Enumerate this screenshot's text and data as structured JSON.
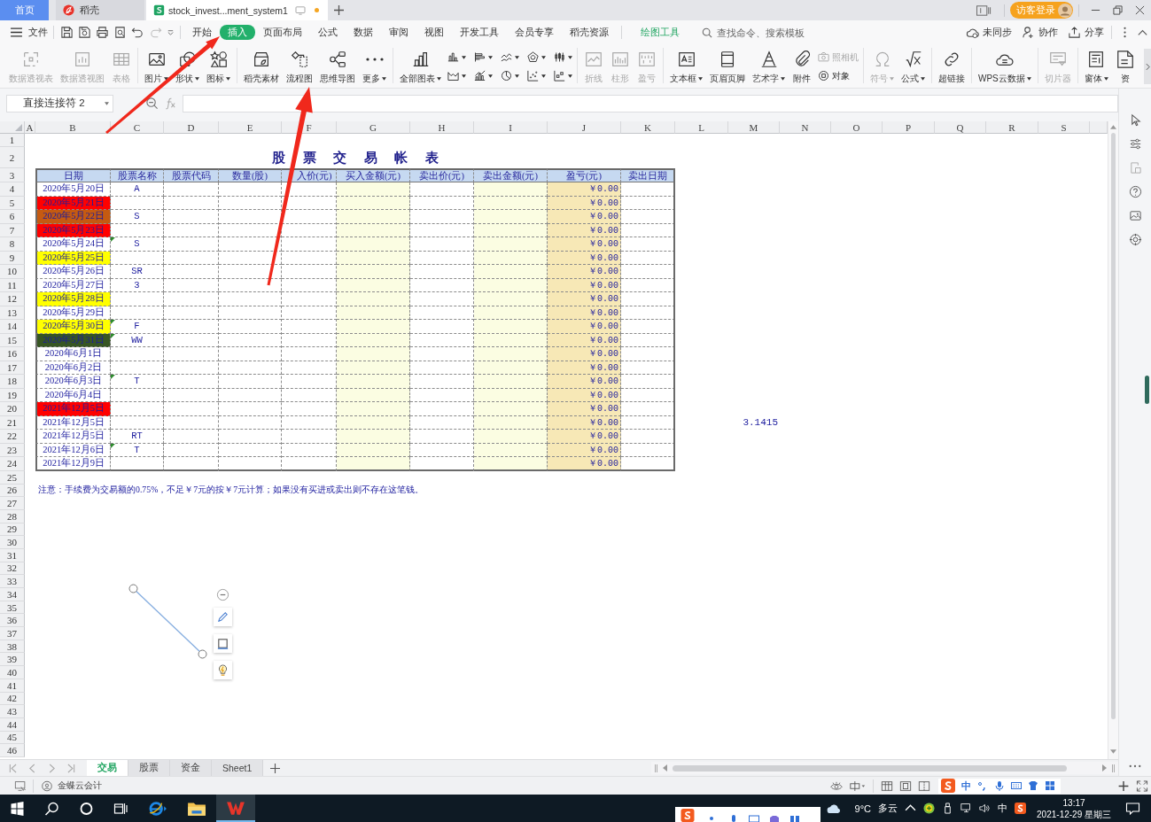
{
  "tabs": [
    {
      "label": "首页",
      "kind": "home",
      "selected": false,
      "modified": false
    },
    {
      "label": "稻壳",
      "kind": "docer",
      "selected": false,
      "modified": false
    },
    {
      "label": "stock_invest...ment_system1",
      "kind": "sheet",
      "selected": true,
      "modified": true
    }
  ],
  "account": {
    "label": "访客登录"
  },
  "menu": {
    "file": "文件",
    "tabs": [
      {
        "label": "开始",
        "selected": false
      },
      {
        "label": "插入",
        "selected": true
      },
      {
        "label": "页面布局",
        "selected": false
      },
      {
        "label": "公式",
        "selected": false
      },
      {
        "label": "数据",
        "selected": false
      },
      {
        "label": "审阅",
        "selected": false
      },
      {
        "label": "视图",
        "selected": false
      },
      {
        "label": "开发工具",
        "selected": false
      },
      {
        "label": "会员专享",
        "selected": false
      },
      {
        "label": "稻壳资源",
        "selected": false
      }
    ],
    "context_tab": "绘图工具",
    "search": {
      "placeholder": "查找命令、搜索模板"
    },
    "actions": [
      {
        "label": "未同步",
        "kind": "cloud"
      },
      {
        "label": "协作",
        "kind": "collab"
      },
      {
        "label": "分享",
        "kind": "share"
      }
    ]
  },
  "ribbon": {
    "groups": [
      {
        "items": [
          {
            "label": "数据透视表",
            "kind": "pivot",
            "disabled": true,
            "dropdown": false
          },
          {
            "label": "数据透视图",
            "kind": "pivotchart",
            "disabled": true,
            "dropdown": false
          },
          {
            "label": "表格",
            "kind": "table",
            "disabled": true,
            "dropdown": false
          }
        ]
      },
      {
        "items": [
          {
            "label": "图片",
            "kind": "picture",
            "disabled": false,
            "dropdown": true
          },
          {
            "label": "形状",
            "kind": "shape",
            "disabled": false,
            "dropdown": true
          },
          {
            "label": "图标",
            "kind": "iconset",
            "disabled": false,
            "dropdown": true
          }
        ]
      },
      {
        "items": [
          {
            "label": "稻壳素材",
            "kind": "material",
            "disabled": false,
            "dropdown": false
          },
          {
            "label": "流程图",
            "kind": "flowchart",
            "disabled": false,
            "dropdown": false
          },
          {
            "label": "思维导图",
            "kind": "mindmap",
            "disabled": false,
            "dropdown": false
          },
          {
            "label": "更多",
            "kind": "more",
            "disabled": false,
            "dropdown": true
          }
        ]
      },
      {
        "items": [
          {
            "label": "全部图表",
            "kind": "allcharts",
            "disabled": false,
            "dropdown": true
          }
        ],
        "small_items": [
          {
            "kind": "column",
            "disabled": false,
            "dropdown": true
          },
          {
            "kind": "bar",
            "disabled": false,
            "dropdown": true
          },
          {
            "kind": "line",
            "disabled": false,
            "dropdown": true
          },
          {
            "kind": "radar",
            "disabled": false,
            "dropdown": true
          },
          {
            "kind": "stock",
            "disabled": false,
            "dropdown": true
          },
          {
            "kind": "area",
            "disabled": false,
            "dropdown": true
          },
          {
            "kind": "combo",
            "disabled": false,
            "dropdown": true
          },
          {
            "kind": "pie",
            "disabled": false,
            "dropdown": true
          },
          {
            "kind": "scatter",
            "disabled": false,
            "dropdown": true
          },
          {
            "kind": "other",
            "disabled": false,
            "dropdown": true
          }
        ]
      },
      {
        "items": [
          {
            "label": "折线",
            "kind": "sparkline",
            "disabled": true,
            "dropdown": false
          },
          {
            "label": "柱形",
            "kind": "sparkcolumn",
            "disabled": true,
            "dropdown": false
          },
          {
            "label": "盈亏",
            "kind": "winloss",
            "disabled": true,
            "dropdown": false
          }
        ]
      },
      {
        "items": [
          {
            "label": "文本框",
            "kind": "textbox",
            "disabled": false,
            "dropdown": true
          },
          {
            "label": "页眉页脚",
            "kind": "headerfooter",
            "disabled": false,
            "dropdown": false
          },
          {
            "label": "艺术字",
            "kind": "wordart",
            "disabled": false,
            "dropdown": true
          },
          {
            "label": "附件",
            "kind": "attachment",
            "disabled": false,
            "dropdown": false
          }
        ],
        "small_items": [
          {
            "label": "照相机",
            "kind": "camera",
            "disabled": true,
            "dropdown": false
          },
          {
            "label": "对象",
            "kind": "object",
            "disabled": false,
            "dropdown": false
          }
        ]
      },
      {
        "items": [
          {
            "label": "符号",
            "kind": "symbol",
            "disabled": true,
            "dropdown": true
          },
          {
            "label": "公式",
            "kind": "formula",
            "disabled": false,
            "dropdown": true
          }
        ]
      },
      {
        "items": [
          {
            "label": "超链接",
            "kind": "hyperlink",
            "disabled": false,
            "dropdown": false
          }
        ]
      },
      {
        "items": [
          {
            "label": "WPS云数据",
            "kind": "clouddata",
            "disabled": false,
            "dropdown": true
          }
        ]
      },
      {
        "items": [
          {
            "label": "切片器",
            "kind": "slicer",
            "disabled": true,
            "dropdown": false
          }
        ]
      },
      {
        "items": [
          {
            "label": "窗体",
            "kind": "form",
            "disabled": false,
            "dropdown": true
          },
          {
            "label": "资",
            "kind": "resource",
            "disabled": false,
            "dropdown": false
          }
        ]
      }
    ]
  },
  "formula_bar": {
    "name_box": "直接连接符 2"
  },
  "sheet": {
    "columns": [
      "A",
      "B",
      "C",
      "D",
      "E",
      "F",
      "G",
      "H",
      "I",
      "J",
      "K",
      "L",
      "M",
      "N",
      "O",
      "P",
      "Q",
      "R",
      "S"
    ],
    "row_numbers": [
      "1",
      "2",
      "3",
      "4",
      "5",
      "6",
      "7",
      "8",
      "9",
      "10",
      "11",
      "12",
      "13",
      "14",
      "15",
      "16",
      "17",
      "18",
      "19",
      "20",
      "21",
      "22",
      "23",
      "24",
      "25",
      "26",
      "27",
      "28",
      "29",
      "30",
      "31",
      "32",
      "33",
      "34",
      "35",
      "36",
      "37",
      "38",
      "39",
      "40",
      "41",
      "42",
      "43",
      "44",
      "45",
      "46"
    ],
    "title": "股 票 交 易 帐 表",
    "table": {
      "headers": [
        "日期",
        "股票名称",
        "股票代码",
        "数量(股)",
        "入价(元)",
        "买入金额(元)",
        "卖出价(元)",
        "卖出金额(元)",
        "盈亏(元)",
        "卖出日期"
      ],
      "rows": [
        {
          "date": "2020年5月20日",
          "name": "A",
          "marked": false,
          "profit": "￥0.00"
        },
        {
          "date": "2020年5月21日",
          "color": "#ff0000",
          "marked": false,
          "profit": "￥0.00"
        },
        {
          "date": "2020年5月22日",
          "color": "#c55a11",
          "name": "S",
          "marked": false,
          "profit": "￥0.00"
        },
        {
          "date": "2020年5月23日",
          "color": "#ff0000",
          "marked": false,
          "profit": "￥0.00"
        },
        {
          "date": "2020年5月24日",
          "name": "S",
          "marked": true,
          "profit": "￥0.00"
        },
        {
          "date": "2020年5月25日",
          "color": "#ffff00",
          "marked": false,
          "profit": "￥0.00"
        },
        {
          "date": "2020年5月26日",
          "name": "SR",
          "marked": false,
          "profit": "￥0.00"
        },
        {
          "date": "2020年5月27日",
          "name": "3",
          "marked": false,
          "profit": "￥0.00"
        },
        {
          "date": "2020年5月28日",
          "color": "#ffff00",
          "marked": false,
          "profit": "￥0.00"
        },
        {
          "date": "2020年5月29日",
          "marked": false,
          "profit": "￥0.00"
        },
        {
          "date": "2020年5月30日",
          "color": "#ffff00",
          "name": "F",
          "marked": true,
          "profit": "￥0.00"
        },
        {
          "date": "2020年5月31日",
          "color": "#375623",
          "name": "WW",
          "marked": true,
          "profit": "￥0.00"
        },
        {
          "date": "2020年6月1日",
          "marked": false,
          "profit": "￥0.00"
        },
        {
          "date": "2020年6月2日",
          "marked": false,
          "profit": "￥0.00"
        },
        {
          "date": "2020年6月3日",
          "name": "T",
          "marked": true,
          "profit": "￥0.00"
        },
        {
          "date": "2020年6月4日",
          "marked": false,
          "profit": "￥0.00"
        },
        {
          "date": "2021年12月5日",
          "color": "#ff0000",
          "marked": false,
          "profit": "￥0.00"
        },
        {
          "date": "2021年12月5日",
          "marked": false,
          "profit": "￥0.00"
        },
        {
          "date": "2021年12月5日",
          "name": "RT",
          "marked": false,
          "profit": "￥0.00"
        },
        {
          "date": "2021年12月6日",
          "name": "T",
          "marked": true,
          "profit": "￥0.00"
        },
        {
          "date": "2021年12月9日",
          "marked": false,
          "profit": "￥0.00"
        }
      ]
    },
    "loose_value": "3.1415",
    "note": "注意：手续费为交易额的0.75%，不足￥7元的按￥7元计算；如果没有买进或卖出则不存在这笔钱。"
  },
  "sheet_tabs": [
    {
      "label": "交易",
      "selected": true
    },
    {
      "label": "股票",
      "selected": false
    },
    {
      "label": "资金",
      "selected": false
    },
    {
      "label": "Sheet1",
      "selected": false
    }
  ],
  "status_bar": {
    "app": "金蝶云会计",
    "ime_mode": "中"
  },
  "taskbar": {
    "apps": [
      {
        "kind": "browser",
        "active": false
      },
      {
        "kind": "folder",
        "active": false
      },
      {
        "kind": "office",
        "active": true
      }
    ],
    "temperature": "9°C",
    "weather": "多云",
    "ime": "中",
    "time": "13:17",
    "date": "2021-12-29 星期三"
  }
}
